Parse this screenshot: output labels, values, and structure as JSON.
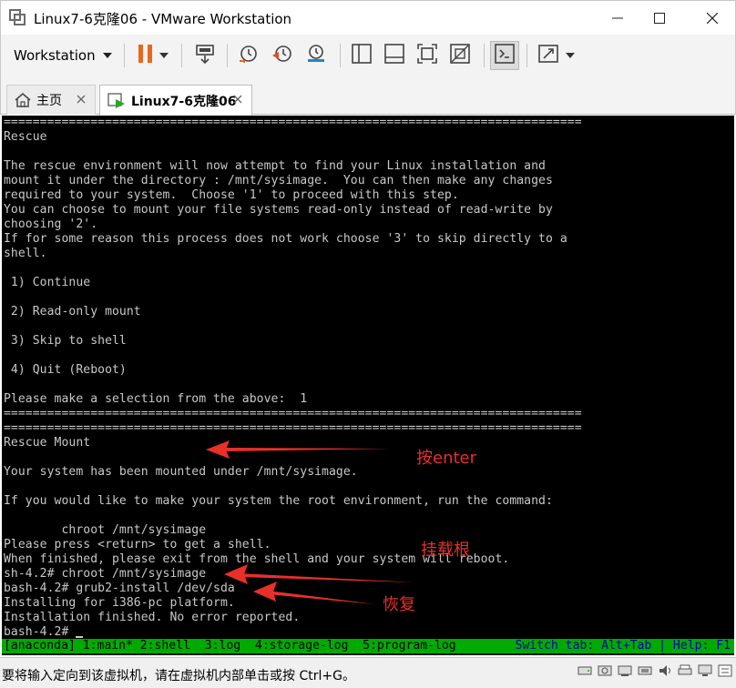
{
  "window": {
    "title": "Linux7-6克隆06 - VMware Workstation"
  },
  "toolbar": {
    "menu_label": "Workstation",
    "icons": [
      "pause-icon",
      "send-ctrl-alt-del-icon",
      "snapshot-icon",
      "revert-snapshot-icon",
      "snapshot-manager-icon",
      "library-view-icon",
      "thumbnail-view-icon",
      "fullscreen-icon",
      "unity-icon",
      "console-view-icon",
      "stretch-icon"
    ]
  },
  "tabs": [
    {
      "label": "主页",
      "icon": "home-icon"
    },
    {
      "label": "Linux7-6克隆06",
      "icon": "vm-running-icon"
    }
  ],
  "console": {
    "lines": [
      "================================================================================",
      "Rescue",
      "",
      "The rescue environment will now attempt to find your Linux installation and",
      "mount it under the directory : /mnt/sysimage.  You can then make any changes",
      "required to your system.  Choose '1' to proceed with this step.",
      "You can choose to mount your file systems read-only instead of read-write by",
      "choosing '2'.",
      "If for some reason this process does not work choose '3' to skip directly to a",
      "shell.",
      "",
      " 1) Continue",
      "",
      " 2) Read-only mount",
      "",
      " 3) Skip to shell",
      "",
      " 4) Quit (Reboot)",
      "",
      "Please make a selection from the above:  1",
      "================================================================================",
      "================================================================================",
      "Rescue Mount",
      "",
      "Your system has been mounted under /mnt/sysimage.",
      "",
      "If you would like to make your system the root environment, run the command:",
      "",
      "        chroot /mnt/sysimage",
      "Please press <return> to get a shell.",
      "When finished, please exit from the shell and your system will reboot.",
      "sh-4.2# chroot /mnt/sysimage",
      "bash-4.2# grub2-install /dev/sda",
      "Installing for i386-pc platform.",
      "Installation finished. No error reported.",
      "bash-4.2# "
    ],
    "tmux_left": "[anaconda] 1:main* 2:shell  3:log  4:storage-log  5:program-log",
    "tmux_right": "Switch tab: Alt+Tab | Help: F1"
  },
  "annotations": {
    "enter": "按enter",
    "mount_root": "挂载根",
    "recover": "恢复"
  },
  "statusbar": {
    "text": "要将输入定向到该虚拟机，请在虚拟机内部单击或按 Ctrl+G。"
  },
  "colors": {
    "console_bg": "#000000",
    "console_fg": "#c8c8c8",
    "tmux_bar": "#00aa00",
    "annotation": "#e8302a",
    "pause_orange": "#e8681f"
  }
}
